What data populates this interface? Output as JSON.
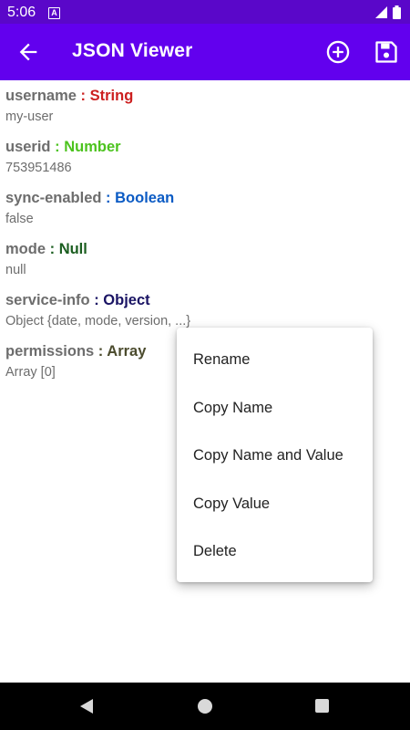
{
  "status_bar": {
    "time": "5:06",
    "notification_glyph": "A"
  },
  "app_bar": {
    "title": "JSON Viewer",
    "icons": [
      "back-arrow-icon",
      "add-circle-icon",
      "save-icon"
    ]
  },
  "colors": {
    "status_bar": "#5a07c9",
    "app_bar": "#6200ee",
    "string": "#cc1f1f",
    "number": "#4cc31e",
    "boolean": "#0b5bc4",
    "null": "#1b5e20",
    "object": "#1a1464",
    "array": "#4b4b2d"
  },
  "items": [
    {
      "key": "username",
      "sep": " : ",
      "type": "String",
      "value": "my-user"
    },
    {
      "key": "userid",
      "sep": " : ",
      "type": "Number",
      "value": "753951486"
    },
    {
      "key": "sync-enabled",
      "sep": " : ",
      "type": "Boolean",
      "value": "false"
    },
    {
      "key": "mode",
      "sep": " : ",
      "type": "Null",
      "value": "null"
    },
    {
      "key": "service-info",
      "sep": " : ",
      "type": "Object",
      "value": "Object {date, mode, version, ...}"
    },
    {
      "key": "permissions",
      "sep": " : ",
      "type": "Array",
      "value": "Array [0]"
    }
  ],
  "context_menu": {
    "items": [
      "Rename",
      "Copy Name",
      "Copy Name and Value",
      "Copy Value",
      "Delete"
    ]
  }
}
